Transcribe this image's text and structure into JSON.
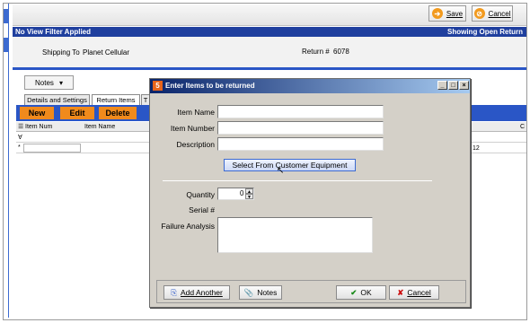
{
  "toolbar": {
    "save_label": "Save",
    "cancel_label": "Cancel"
  },
  "status": {
    "left": "No View Filter Applied",
    "right": "Showing Open Return"
  },
  "info": {
    "shipping_label": "Shipping To",
    "shipping_value": "Planet Cellular",
    "return_label": "Return #",
    "return_value": "6078"
  },
  "notes_dropdown": {
    "label": "Notes"
  },
  "tabs": [
    {
      "label": "Details and Settings"
    },
    {
      "label": "Return Items"
    },
    {
      "label": "T"
    }
  ],
  "actions": {
    "new": "New",
    "edit": "Edit",
    "delete": "Delete"
  },
  "grid": {
    "col_item_num": "Item Num",
    "col_item_name": "Item Name",
    "col_right": "C",
    "row_value": "12"
  },
  "dialog": {
    "title": "Enter Items to be returned",
    "item_name_label": "Item Name",
    "item_name_value": "",
    "item_number_label": "Item Number",
    "item_number_value": "",
    "description_label": "Description",
    "description_value": "",
    "select_button": "Select From Customer Equipment",
    "quantity_label": "Quantity",
    "quantity_value": "0",
    "serial_label": "Serial #",
    "failure_label": "Failure Analysis",
    "failure_value": "",
    "add_another": "Add Another",
    "notes": "Notes",
    "ok": "OK",
    "cancel": "Cancel"
  },
  "colors": {
    "accent_blue": "#2a56c6",
    "title_blue": "#0a246a",
    "orange": "#f08a1c"
  }
}
